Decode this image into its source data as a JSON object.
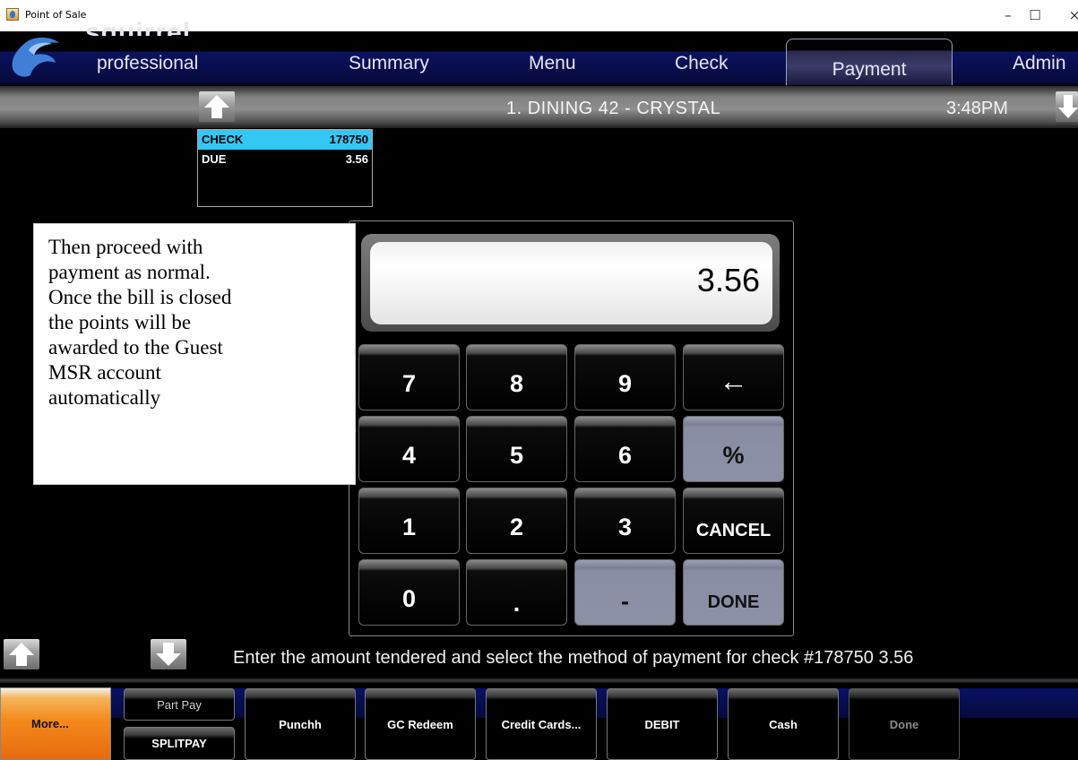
{
  "window": {
    "title": "Point of Sale",
    "controls": [
      "–",
      "☐",
      "×"
    ]
  },
  "logo": {
    "top": "squirrel",
    "sub": "professional"
  },
  "nav": {
    "tabs": [
      "Summary",
      "Menu",
      "Check",
      "Payment",
      "Admin"
    ],
    "active": "Payment"
  },
  "header": {
    "table": "1. DINING 42 - CRYSTAL",
    "time": "3:48PM"
  },
  "check": {
    "check_label": "CHECK",
    "check_number": "178750",
    "due_label": "DUE",
    "due_amount": "3.56"
  },
  "note": {
    "text": "Then proceed with\npayment as normal.\nOnce the bill is closed\nthe points will be\nawarded to the Guest\nMSR account\nautomatically"
  },
  "display": {
    "value": "3.56"
  },
  "keys": {
    "k7": "7",
    "k8": "8",
    "k9": "9",
    "backspace": "←",
    "k4": "4",
    "k5": "5",
    "k6": "6",
    "percent": "%",
    "k1": "1",
    "k2": "2",
    "k3": "3",
    "cancel": "CANCEL",
    "k0": "0",
    "dot": ".",
    "minus": "-",
    "done": "DONE"
  },
  "status": {
    "message": "Enter the amount tendered and select the method of payment for check #178750 3.56"
  },
  "footer": {
    "more": "More...",
    "part_pay": "Part Pay",
    "splitpay": "SPLITPAY",
    "punchh": "Punchh",
    "gc_redeem": "GC Redeem",
    "credit_cards": "Credit Cards...",
    "debit": "DEBIT",
    "cash": "Cash",
    "done": "Done"
  },
  "colors": {
    "check_highlight": "#33c8f4",
    "more_button": "#f38a1a",
    "nav_band": "#0b1260"
  }
}
